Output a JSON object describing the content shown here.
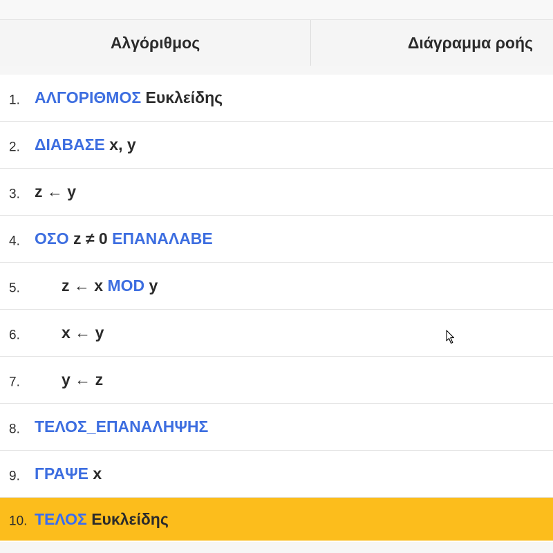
{
  "tabs": {
    "algorithm": "Αλγόριθμος",
    "flowchart": "Διάγραμμα ροής"
  },
  "lines": [
    {
      "num": "1.",
      "parts": [
        {
          "t": "ΑΛΓΟΡΙΘΜΟΣ",
          "kw": true
        },
        {
          "t": " Ευκλείδης",
          "kw": false
        }
      ]
    },
    {
      "num": "2.",
      "parts": [
        {
          "t": "ΔΙΑΒΑΣΕ",
          "kw": true
        },
        {
          "t": " x, y",
          "kw": false
        }
      ]
    },
    {
      "num": "3.",
      "parts": [
        {
          "t": "z ← y",
          "kw": false
        }
      ]
    },
    {
      "num": "4.",
      "parts": [
        {
          "t": "ΟΣΟ",
          "kw": true
        },
        {
          "t": " z ≠ 0 ",
          "kw": false
        },
        {
          "t": "ΕΠΑΝΑΛΑΒΕ",
          "kw": true
        }
      ]
    },
    {
      "num": "5.",
      "parts": [
        {
          "t": "z ← x ",
          "kw": false
        },
        {
          "t": "MOD",
          "kw": true
        },
        {
          "t": " y",
          "kw": false
        }
      ]
    },
    {
      "num": "6.",
      "parts": [
        {
          "t": "x ← y",
          "kw": false
        }
      ]
    },
    {
      "num": "7.",
      "parts": [
        {
          "t": "y ← z",
          "kw": false
        }
      ]
    },
    {
      "num": "8.",
      "parts": [
        {
          "t": "ΤΕΛΟΣ_ΕΠΑΝΑΛΗΨΗΣ",
          "kw": true
        }
      ]
    },
    {
      "num": "9.",
      "parts": [
        {
          "t": "ΓΡΑΨΕ",
          "kw": true
        },
        {
          "t": " x",
          "kw": false
        }
      ]
    },
    {
      "num": "10.",
      "parts": [
        {
          "t": "ΤΕΛΟΣ",
          "kw": true
        },
        {
          "t": " Ευκλείδης",
          "kw": false
        }
      ]
    }
  ],
  "colors": {
    "keyword": "#3d6ee0",
    "active_line": "#fcbd1c",
    "text": "#2b2b2b"
  }
}
